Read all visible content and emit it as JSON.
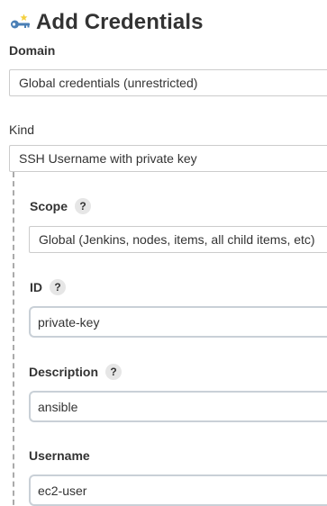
{
  "header": {
    "title": "Add Credentials",
    "icon": "key-icon"
  },
  "domain": {
    "label": "Domain",
    "value": "Global credentials (unrestricted)"
  },
  "kind": {
    "label": "Kind",
    "value": "SSH Username with private key"
  },
  "scope": {
    "label": "Scope",
    "help": "?",
    "value": "Global (Jenkins, nodes, items, all child items, etc)"
  },
  "id_field": {
    "label": "ID",
    "help": "?",
    "value": "private-key"
  },
  "description": {
    "label": "Description",
    "help": "?",
    "value": "ansible"
  },
  "username": {
    "label": "Username",
    "value": "ec2-user"
  },
  "colors": {
    "input_border": "#c9d0d7",
    "select_border": "#cccccc",
    "help_bg": "#e6e6e6",
    "nested_border": "#aaaaaa",
    "key_icon_blue": "#4a7fb5",
    "key_icon_yellow": "#f4d03f"
  }
}
